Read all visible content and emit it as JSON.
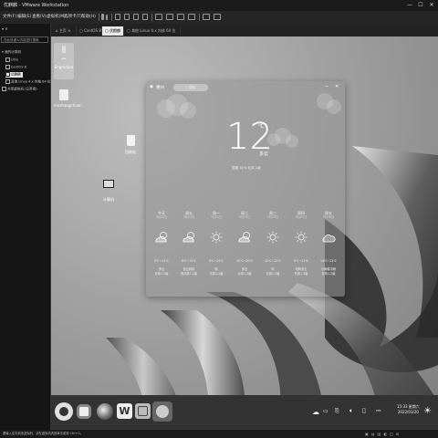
{
  "window": {
    "title": "优麒麟 - VMware Workstation",
    "controls": {
      "minimize": "—",
      "maximize": "☐",
      "close": "✕"
    }
  },
  "menu": {
    "items": [
      "文件(F)",
      "编辑(E)",
      "查看(V)",
      "虚拟机(M)",
      "选项卡(T)",
      "帮助(H)"
    ]
  },
  "library": {
    "search_placeholder": "在此处键入内容进行搜索",
    "items": [
      {
        "label": "我的计算机",
        "indent": 0
      },
      {
        "label": "UOS",
        "indent": 1
      },
      {
        "label": "CentOS 8",
        "indent": 1
      },
      {
        "label": "优麒麟",
        "indent": 1,
        "selected": true
      },
      {
        "label": "其他 Linux 4.x 内核 64 位",
        "indent": 1
      },
      {
        "label": "共享虚拟机 (已弃用)",
        "indent": 0
      }
    ]
  },
  "tabs": [
    {
      "label": "主页",
      "active": false
    },
    {
      "label": "CentOS 8",
      "active": false
    },
    {
      "label": "优麒麟",
      "active": true
    },
    {
      "label": "其他 Linux 4.x 内核 64 位",
      "active": false
    }
  ],
  "desktop": {
    "icons": [
      {
        "name": "Engrampa",
        "label": "Engrampa"
      },
      {
        "name": "home-folder",
        "label": "moshangchuan"
      },
      {
        "name": "trash",
        "label": "回收站"
      },
      {
        "name": "computer",
        "label": "计算机"
      }
    ]
  },
  "weather": {
    "city": "惠州",
    "search_placeholder": "搜索",
    "temperature": "12",
    "unit": "℃",
    "condition": "多云",
    "details": "湿度 51%  北风 1级",
    "forecast": [
      {
        "day": "今天",
        "date": "3月20日",
        "icon": "cloud-sun",
        "temp": "9℃~12℃",
        "cond": "多云",
        "wind": "北风1-2级"
      },
      {
        "day": "周五",
        "date": "3月21日",
        "icon": "cloud-sun",
        "temp": "8℃~15℃",
        "cond": "多云转晴",
        "wind": "西北风1-2级"
      },
      {
        "day": "周一",
        "date": "3月22日",
        "icon": "sun",
        "temp": "9℃~19℃",
        "cond": "晴",
        "wind": "东风1-2级"
      },
      {
        "day": "周二",
        "date": "3月23日",
        "icon": "cloud-sun",
        "temp": "10℃~20℃",
        "cond": "多云",
        "wind": "北风1-2级"
      },
      {
        "day": "周三",
        "date": "3月24日",
        "icon": "sun",
        "temp": "12℃~22℃",
        "cond": "晴",
        "wind": "东风1-2级"
      },
      {
        "day": "周四",
        "date": "3月25日",
        "icon": "sun",
        "temp": "9℃~23℃",
        "cond": "晴转多云",
        "wind": "东风1-2级"
      },
      {
        "day": "周五",
        "date": "3月26日",
        "icon": "cloud",
        "temp": "14℃~22℃",
        "cond": "小雨转中雨",
        "wind": "北风1-2级"
      }
    ]
  },
  "taskbar": {
    "apps": [
      "start-menu",
      "multitask-view",
      "firefox",
      "wps-writer",
      "kylin-software-center",
      "weather"
    ],
    "time": "15:33 星期六",
    "date": "2022/03/20"
  },
  "statusbar": {
    "text": "要输入定向到该虚拟机，请在虚拟机内部单击或按 Ctrl+G。"
  },
  "colors": {
    "app_chrome": "#1e1e1e",
    "active_tab": "#e9e9e9",
    "desktop_bg": "#a0a0a0",
    "taskbar": "#333333"
  }
}
